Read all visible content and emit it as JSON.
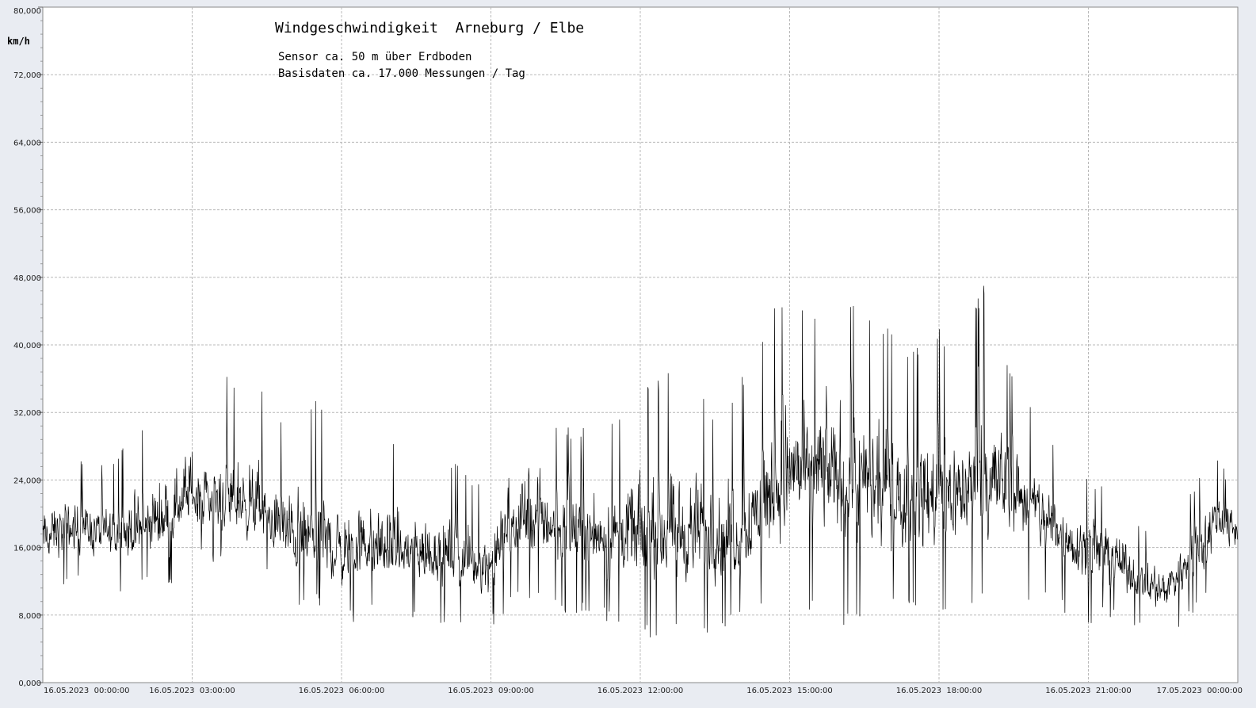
{
  "chart_data": {
    "type": "line",
    "title": "Windgeschwindigkeit  Arneburg / Elbe",
    "subtitle_lines": [
      "Sensor ca. 50 m über Erdboden",
      "Basisdaten ca. 17.000 Messungen / Tag"
    ],
    "ylabel": "km/h",
    "ylim": [
      0,
      80
    ],
    "yticks": [
      0,
      8,
      16,
      24,
      32,
      40,
      48,
      56,
      64,
      72,
      80
    ],
    "ytick_labels": [
      "0,000",
      "8,000",
      "16,000",
      "24,000",
      "32,000",
      "40,000",
      "48,000",
      "56,000",
      "64,000",
      "72,000",
      "80,000"
    ],
    "xlim_hours": [
      0,
      24
    ],
    "xticks_hours": [
      0,
      3,
      6,
      9,
      12,
      15,
      18,
      21,
      24
    ],
    "xtick_labels": [
      "16.05.2023  00:00:00",
      "16.05.2023  03:00:00",
      "16.05.2023  06:00:00",
      "16.05.2023  09:00:00",
      "16.05.2023  12:00:00",
      "16.05.2023  15:00:00",
      "16.05.2023  18:00:00",
      "16.05.2023  21:00:00",
      "17.05.2023  00:00:00"
    ],
    "grid": true,
    "line_color": "#000000",
    "series": [
      {
        "x_hours": [
          0,
          0.5,
          1,
          1.5,
          2,
          2.5,
          3,
          3.5,
          4,
          4.5,
          5,
          5.5,
          6,
          6.5,
          7,
          7.5,
          8,
          8.5,
          9,
          9.5,
          10,
          10.5,
          11,
          11.5,
          12,
          12.5,
          13,
          13.5,
          14,
          14.5,
          15,
          15.5,
          16,
          16.5,
          17,
          17.5,
          18,
          18.5,
          19,
          19.5,
          20,
          20.5,
          21,
          21.5,
          22,
          22.5,
          23,
          23.5,
          24
        ],
        "mean": [
          17,
          18,
          18,
          17,
          18,
          20,
          22,
          21,
          21,
          19,
          17,
          16,
          15,
          16,
          15,
          15,
          15,
          14,
          14,
          19,
          19,
          18,
          18,
          17,
          17,
          17,
          17,
          17,
          17,
          21,
          25,
          24,
          25,
          22,
          22,
          21,
          22,
          22,
          23,
          23,
          20,
          17,
          16,
          15,
          12,
          11,
          14,
          19,
          18
        ],
        "min": [
          10,
          11,
          11,
          10,
          11,
          10,
          15,
          13,
          13,
          12,
          7,
          9,
          6,
          8,
          8,
          7,
          7,
          6,
          6,
          10,
          9,
          8,
          8,
          6,
          5,
          5,
          5,
          6,
          7,
          8,
          7,
          9,
          7,
          6,
          8,
          8,
          7,
          9,
          9,
          9,
          10,
          8,
          7,
          7,
          6,
          5,
          7,
          10,
          13
        ],
        "max": [
          26,
          27,
          26,
          27,
          31,
          33,
          38,
          36,
          37,
          34,
          31,
          34,
          30,
          29,
          29,
          27,
          28,
          25,
          24,
          39,
          34,
          31,
          30,
          31,
          35,
          37,
          36,
          32,
          36,
          42,
          48,
          44,
          46,
          45,
          42,
          40,
          42,
          41,
          49,
          36,
          32,
          28,
          25,
          23,
          19,
          17,
          22,
          27,
          24
        ]
      }
    ]
  }
}
